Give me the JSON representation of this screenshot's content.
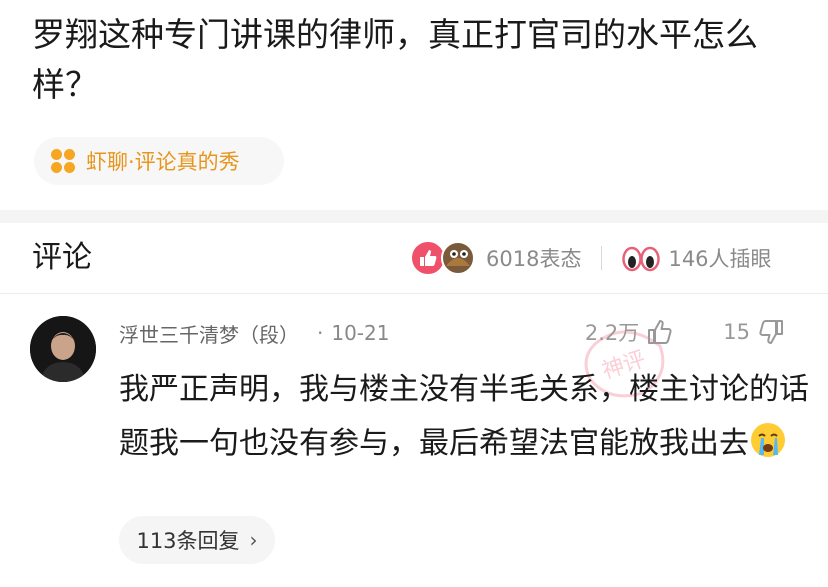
{
  "question": {
    "title": "罗翔这种专门讲课的律师，真正打官司的水平怎么样？"
  },
  "tag": {
    "label": "虾聊·评论真的秀",
    "icon": "four-dots-icon",
    "color": "#f5a623"
  },
  "comments_section": {
    "title": "评论",
    "reactions_label": "6018表态",
    "watching_label": "146人插眼"
  },
  "comment": {
    "username": "浮世三千清梦（段）",
    "separator": "·",
    "date": "10-21",
    "likes": "2.2万",
    "dislikes": "15",
    "text": "我严正声明，我与楼主没有半毛关系，楼主讨论的话题我一句也没有参与，最后希望法官能放我出去",
    "emoji": "crying-face-icon",
    "replies_label": "113条回复",
    "watermark": "神评"
  },
  "colors": {
    "accent": "#f5a623",
    "like": "#f0516a",
    "watermark": "#f7a8b8"
  }
}
